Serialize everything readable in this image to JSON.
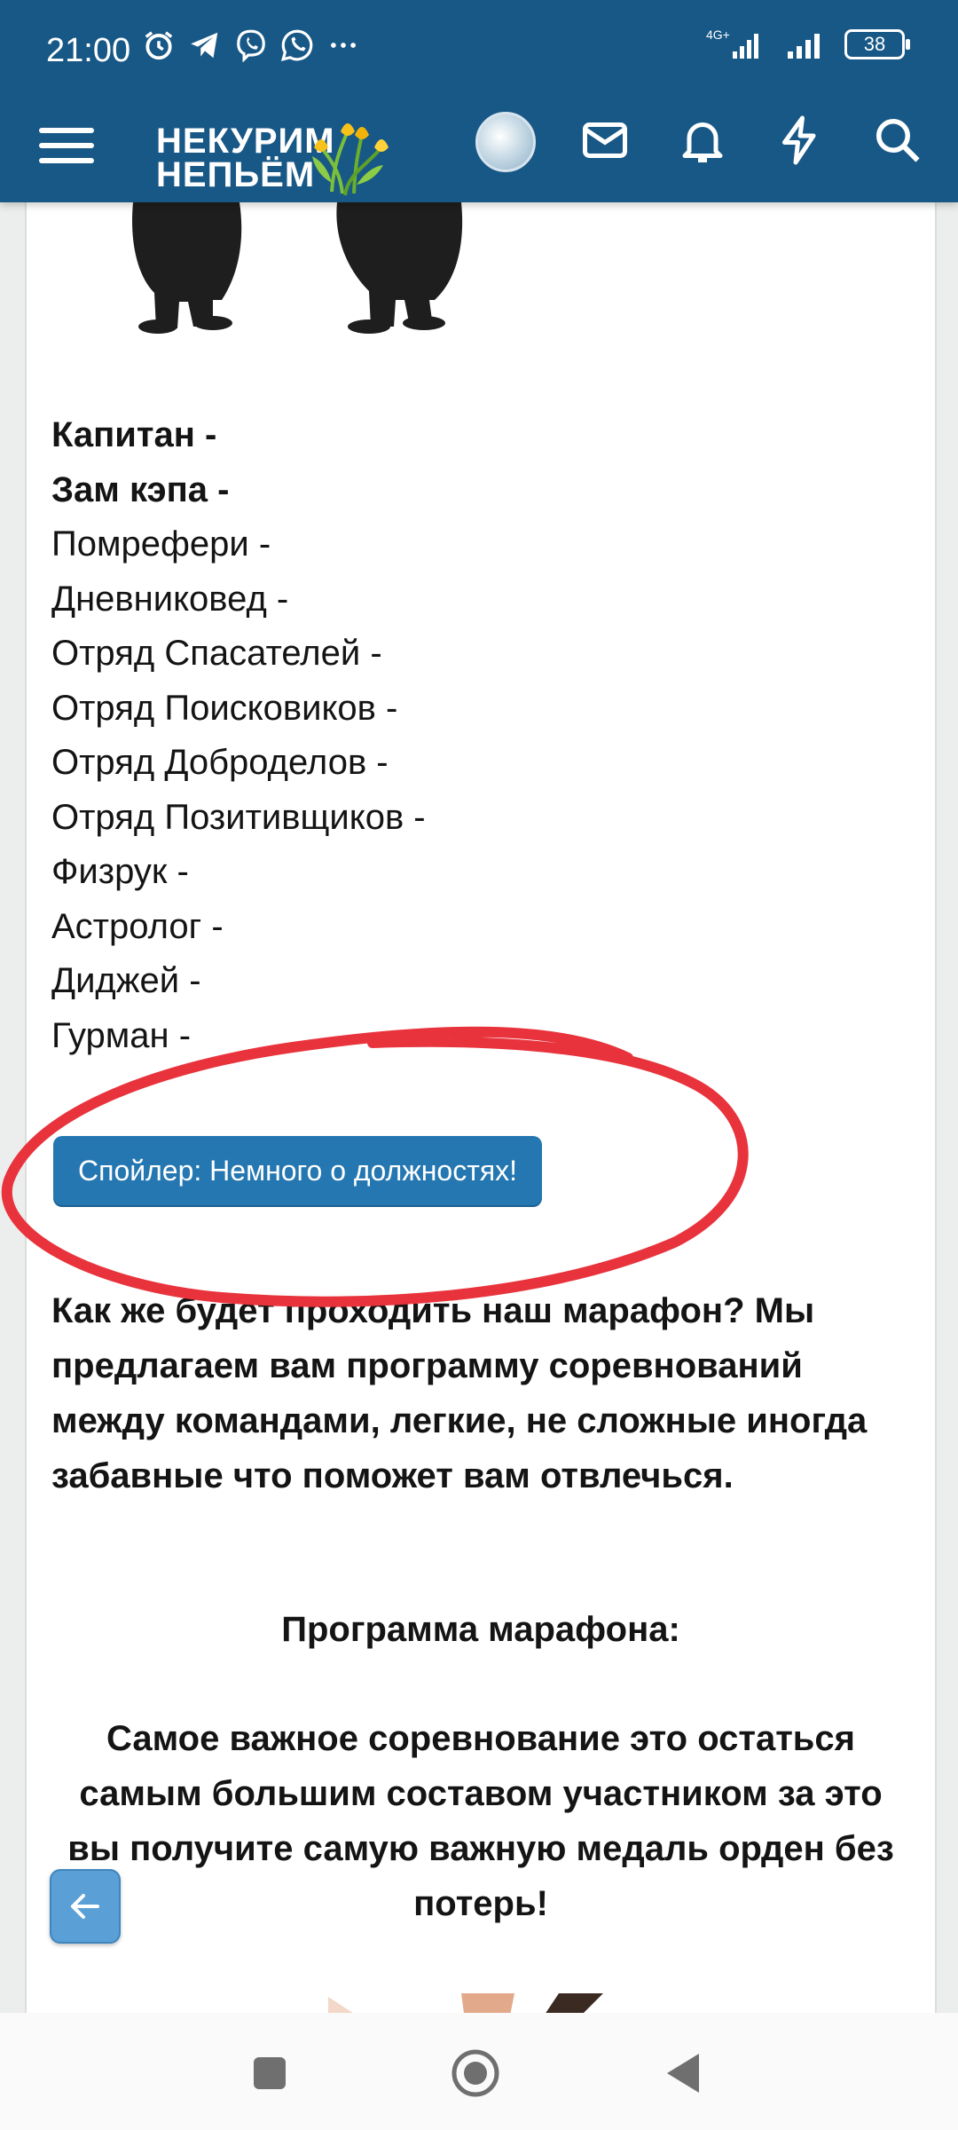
{
  "status": {
    "time": "21:00",
    "network": "4G+",
    "battery": "38"
  },
  "header": {
    "logo_line1": "НЕКУРИМ",
    "logo_line2": "НЕПЬЁМ",
    "icons": [
      "menu-icon",
      "avatar",
      "mail-icon",
      "bell-icon",
      "lightning-icon",
      "search-icon"
    ],
    "background": "#185886"
  },
  "content": {
    "roles": [
      {
        "text": "Капитан -",
        "bold": true
      },
      {
        "text": "Зам кэпа -",
        "bold": true
      },
      {
        "text": "Помрефери -",
        "bold": false
      },
      {
        "text": "Дневниковед -",
        "bold": false
      },
      {
        "text": "Отряд Спасателей -",
        "bold": false
      },
      {
        "text": "Отряд Поисковиков -",
        "bold": false
      },
      {
        "text": "Отряд Доброделов -",
        "bold": false
      },
      {
        "text": "Отряд Позитивщиков -",
        "bold": false
      },
      {
        "text": "Физрук -",
        "bold": false
      },
      {
        "text": "Астролог -",
        "bold": false
      },
      {
        "text": "Диджей -",
        "bold": false
      },
      {
        "text": "Гурман -",
        "bold": false
      }
    ],
    "spoiler_label": "Спойлер: Немного о должностях!",
    "paragraph": "Как же будет проходить наш марафон? Мы предлагаем вам программу соревнований между командами, легкие, не сложные иногда забавные что поможет вам отвлечься.",
    "program_title": "Программа марафона:",
    "program_text": "Самое важное соревнование это остаться самым большим составом участником за это вы получите самую важную медаль орден без потерь!"
  },
  "colors": {
    "accent": "#2577b1",
    "annotation": "#e8333c"
  },
  "nav": [
    "recent-apps-icon",
    "home-icon",
    "back-icon"
  ]
}
